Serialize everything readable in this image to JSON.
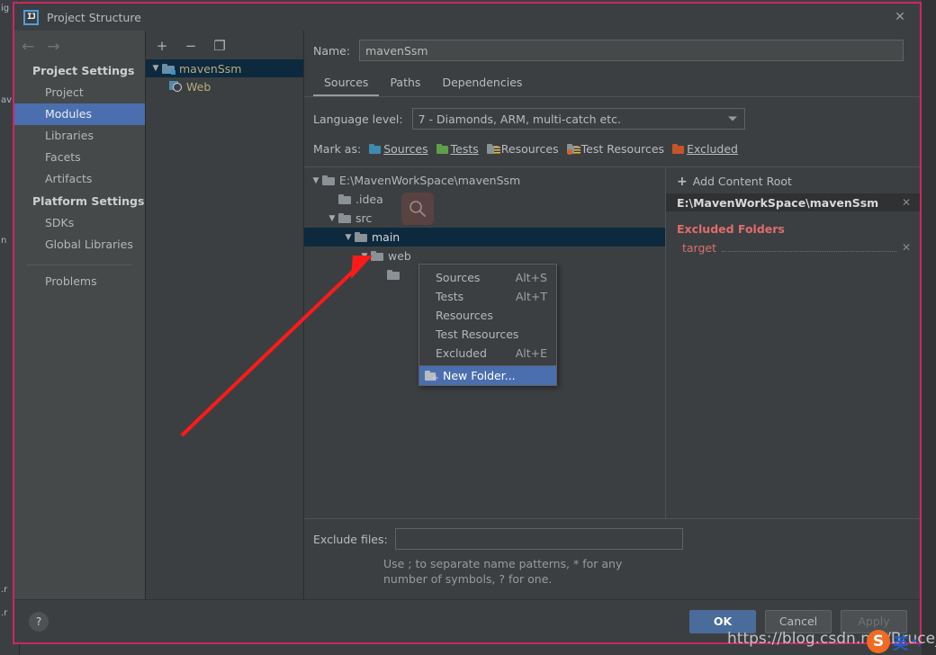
{
  "window": {
    "title": "Project Structure",
    "logo_text": "IJ",
    "close_icon": "✕"
  },
  "background": {
    "fragments": [
      "ig",
      "av",
      "n",
      ".r",
      ".r"
    ]
  },
  "sidebar": {
    "back_icon": "←",
    "forward_icon": "→",
    "groups": [
      {
        "label": "Project Settings",
        "items": [
          {
            "label": "Project",
            "selected": false
          },
          {
            "label": "Modules",
            "selected": true
          },
          {
            "label": "Libraries",
            "selected": false
          },
          {
            "label": "Facets",
            "selected": false
          },
          {
            "label": "Artifacts",
            "selected": false
          }
        ]
      },
      {
        "label": "Platform Settings",
        "items": [
          {
            "label": "SDKs",
            "selected": false
          },
          {
            "label": "Global Libraries",
            "selected": false
          }
        ]
      }
    ],
    "problems": {
      "label": "Problems"
    }
  },
  "modules": {
    "toolbar": {
      "add_icon": "+",
      "remove_icon": "−",
      "copy_icon": "❐"
    },
    "tree": [
      {
        "label": "mavenSsm",
        "type": "module",
        "expanded": true,
        "selected": true,
        "depth": 0
      },
      {
        "label": "Web",
        "type": "facet",
        "expanded": false,
        "selected": false,
        "depth": 1
      }
    ]
  },
  "detail": {
    "name_label": "Name:",
    "name_value": "mavenSsm",
    "name_placeholder": "",
    "tabs": [
      {
        "label": "Sources",
        "active": true
      },
      {
        "label": "Paths",
        "active": false
      },
      {
        "label": "Dependencies",
        "active": false
      }
    ],
    "language_level": {
      "label": "Language level:",
      "value": "7 - Diamonds, ARM, multi-catch etc."
    },
    "mark_as": {
      "label": "Mark as:",
      "options": [
        {
          "label": "Sources",
          "color": "#3f8bb0"
        },
        {
          "label": "Tests",
          "color": "#5f9e4a"
        },
        {
          "label": "Resources",
          "color": "#8a9296"
        },
        {
          "label": "Test Resources",
          "color": "#8a9296"
        },
        {
          "label": "Excluded",
          "color": "#c5562a"
        }
      ]
    },
    "tree": [
      {
        "label": "E:\\MavenWorkSpace\\mavenSsm",
        "depth": 0,
        "expanded": true,
        "selected": false
      },
      {
        "label": ".idea",
        "depth": 1,
        "expanded": null,
        "selected": false
      },
      {
        "label": "src",
        "depth": 1,
        "expanded": true,
        "selected": false
      },
      {
        "label": "main",
        "depth": 2,
        "expanded": true,
        "selected": true
      },
      {
        "label": "web",
        "depth": 3,
        "expanded": true,
        "selected": false
      },
      {
        "label": "",
        "depth": 4,
        "expanded": null,
        "selected": false
      }
    ],
    "search_overlay_icon": "search-icon",
    "exclude_files": {
      "label": "Exclude files:",
      "value": "",
      "placeholder": "",
      "hint": "Use ; to separate name patterns, * for any number of symbols, ? for one."
    }
  },
  "content_roots": {
    "add_label": "Add Content Root",
    "add_icon": "+",
    "root_path": "E:\\MavenWorkSpace\\mavenSsm",
    "remove_icon": "✕",
    "excluded_title": "Excluded Folders",
    "excluded_items": [
      {
        "label": "target",
        "remove_icon": "✕"
      }
    ],
    "excluded_color": "#e06c6c"
  },
  "context_menu": {
    "items": [
      {
        "label": "Sources",
        "shortcut": "Alt+S",
        "highlight": false
      },
      {
        "label": "Tests",
        "shortcut": "Alt+T",
        "highlight": false
      },
      {
        "label": "Resources",
        "shortcut": "",
        "highlight": false
      },
      {
        "label": "Test Resources",
        "shortcut": "",
        "highlight": false
      },
      {
        "label": "Excluded",
        "shortcut": "Alt+E",
        "highlight": false
      },
      {
        "label": "New Folder...",
        "shortcut": "",
        "highlight": true
      }
    ]
  },
  "footer": {
    "help_icon": "?",
    "ok_label": "OK",
    "cancel_label": "Cancel",
    "apply_label": "Apply"
  },
  "overlay": {
    "watermark": "https://blog.csdn.net/Bruce_Tan",
    "ime_logo": "S",
    "ime_lang": "英",
    "ime_dots": "•,"
  },
  "colors": {
    "accent_selection": "#4b6eaf",
    "tree_selection": "#0d293e",
    "dialog_border": "#cc2663",
    "excluded_red": "#e06c6c",
    "primary_button": "#4a6c9b"
  }
}
